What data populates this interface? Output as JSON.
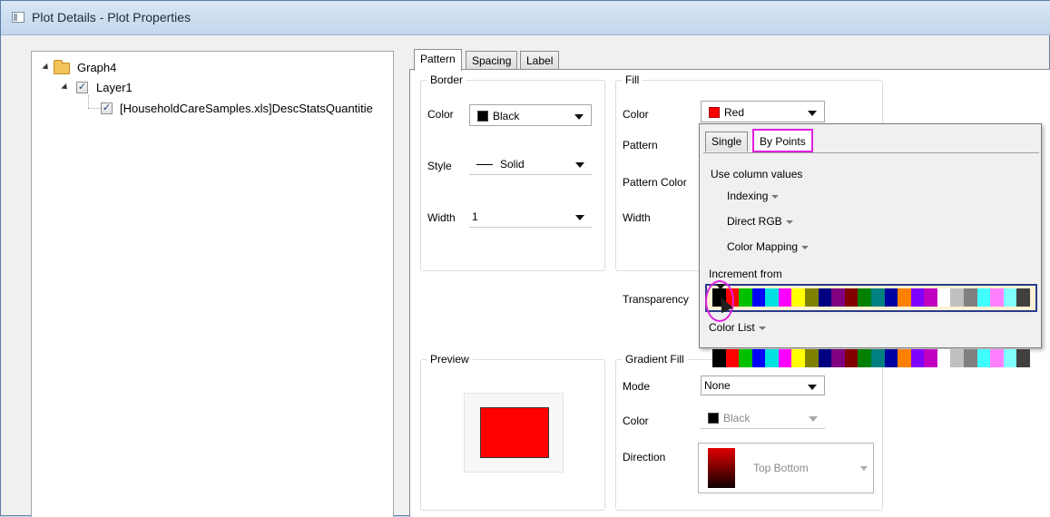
{
  "window": {
    "title": "Plot Details - Plot Properties"
  },
  "tree": {
    "graph": "Graph4",
    "layer": "Layer1",
    "plot": "[HouseholdCareSamples.xls]DescStatsQuantitie"
  },
  "tabs": [
    "Pattern",
    "Spacing",
    "Label"
  ],
  "border": {
    "legend": "Border",
    "color_label": "Color",
    "color_value": "Black",
    "color_hex": "#000000",
    "style_label": "Style",
    "style_value": "Solid",
    "width_label": "Width",
    "width_value": "1"
  },
  "fill": {
    "legend": "Fill",
    "color_label": "Color",
    "color_value": "Red",
    "color_hex": "#ff0000",
    "pattern_label": "Pattern",
    "pattern_color_label": "Pattern Color",
    "width_label": "Width"
  },
  "transparency_label": "Transparency",
  "preview": {
    "legend": "Preview",
    "fill_hex": "#ff0000"
  },
  "gradient": {
    "legend": "Gradient Fill",
    "mode_label": "Mode",
    "mode_value": "None",
    "color_label": "Color",
    "color_value": "Black",
    "direction_label": "Direction",
    "direction_value": "Top Bottom"
  },
  "popup": {
    "tabs": [
      "Single",
      "By Points"
    ],
    "use_column_values": "Use column values",
    "indexing": "Indexing",
    "direct_rgb": "Direct RGB",
    "color_mapping": "Color Mapping",
    "increment_from": "Increment from",
    "color_list": "Color List",
    "palette": [
      "#000000",
      "#ff0000",
      "#00c000",
      "#0000ff",
      "#00e0e0",
      "#ff00ff",
      "#ffff00",
      "#808000",
      "#000080",
      "#800080",
      "#800000",
      "#008000",
      "#008080",
      "#0000a0",
      "#ff8000",
      "#8000ff",
      "#c000c0",
      "#ffffff",
      "#c0c0c0",
      "#808080",
      "#40ffff",
      "#ff80ff",
      "#80ffff",
      "#404040"
    ]
  }
}
